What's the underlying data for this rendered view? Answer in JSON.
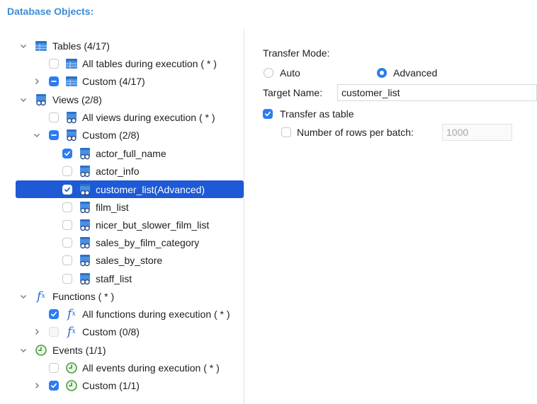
{
  "header": {
    "title": "Database Objects:"
  },
  "tree": {
    "tables": {
      "label": "Tables (4/17)",
      "all_label": "All tables during execution ( * )",
      "custom_label": "Custom (4/17)"
    },
    "views": {
      "label": "Views (2/8)",
      "all_label": "All views during execution ( * )",
      "custom_label": "Custom (2/8)",
      "items": [
        {
          "label": "actor_full_name",
          "checked": true
        },
        {
          "label": "actor_info",
          "checked": false
        },
        {
          "label": "customer_list(Advanced)",
          "checked": true,
          "selected": true
        },
        {
          "label": "film_list",
          "checked": false
        },
        {
          "label": "nicer_but_slower_film_list",
          "checked": false
        },
        {
          "label": "sales_by_film_category",
          "checked": false
        },
        {
          "label": "sales_by_store",
          "checked": false
        },
        {
          "label": "staff_list",
          "checked": false
        }
      ]
    },
    "functions": {
      "label": "Functions ( * )",
      "all_label": "All functions during execution ( * )",
      "custom_label": "Custom (0/8)"
    },
    "events": {
      "label": "Events (1/1)",
      "all_label": "All events during execution ( * )",
      "custom_label": "Custom (1/1)"
    }
  },
  "panel": {
    "transfer_mode_label": "Transfer Mode:",
    "auto_label": "Auto",
    "advanced_label": "Advanced",
    "selected_mode": "Advanced",
    "target_name_label": "Target Name:",
    "target_name_value": "customer_list",
    "transfer_as_table_label": "Transfer as table",
    "transfer_as_table_checked": true,
    "rows_per_batch_label": "Number of rows per batch:",
    "rows_per_batch_value": "1000",
    "rows_per_batch_checked": false
  },
  "colors": {
    "accent": "#2b7cf2",
    "selection": "#1e5ad6",
    "header_text": "#3d8dd6"
  }
}
